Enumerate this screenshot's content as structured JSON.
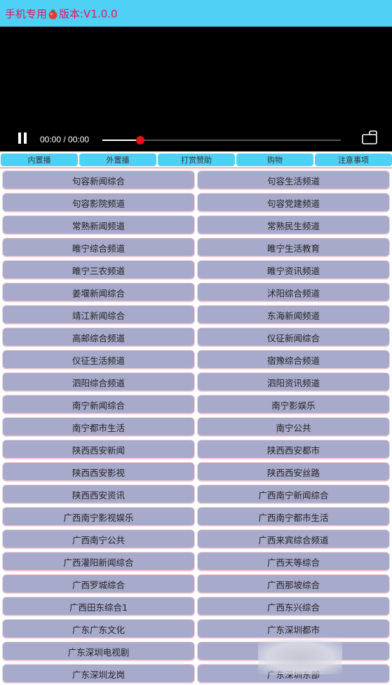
{
  "header": {
    "title_part1": "手机专用",
    "title_part2": "版本:V1.0.0",
    "logo_icon": "tomato-icon",
    "title_color": "#d81b60",
    "bg_color": "#4fd0f5"
  },
  "player": {
    "time": "00:00 / 00:00",
    "progress": 0.16,
    "pause_icon": "pause-icon",
    "fullscreen_icon": "fullscreen-icon",
    "knob_color": "#e8101f"
  },
  "tabs": [
    "内置播",
    "外置播",
    "打赏赞助",
    "购物",
    "注意事项"
  ],
  "channels": [
    [
      "句容新闻综合",
      "句容生活频道"
    ],
    [
      "句容影院频道",
      "句容党建频道"
    ],
    [
      "常熟新闻频道",
      "常熟民生频道"
    ],
    [
      "睢宁综合频道",
      "睢宁生活教育"
    ],
    [
      "睢宁三农频道",
      "睢宁资讯频道"
    ],
    [
      "姜堰新闻综合",
      "沭阳综合频道"
    ],
    [
      "靖江新闻综合",
      "东海新闻频道"
    ],
    [
      "高邮综合频道",
      "仪征新闻综合"
    ],
    [
      "仪征生活频道",
      "宿豫综合频道"
    ],
    [
      "泗阳综合频道",
      "泗阳资讯频道"
    ],
    [
      "南宁新闻综合",
      "南宁影娱乐"
    ],
    [
      "南宁都市生活",
      "南宁公共"
    ],
    [
      "陕西西安新闻",
      "陕西西安都市"
    ],
    [
      "陕西西安影视",
      "陕西西安丝路"
    ],
    [
      "陕西西安资讯",
      "广西南宁新闻综合"
    ],
    [
      "广西南宁影视娱乐",
      "广西南宁都市生活"
    ],
    [
      "广西南宁公共",
      "广西来宾综合频道"
    ],
    [
      "广西灌阳新闻综合",
      "广西天等综合"
    ],
    [
      "广西罗城综合",
      "广西那坡综合"
    ],
    [
      "广西田东综合1",
      "广西东兴综合"
    ],
    [
      "广东广东文化",
      "广东深圳都市"
    ],
    [
      "广东深圳电视剧",
      ""
    ],
    [
      "广东深圳龙岗",
      "广东深圳东部"
    ]
  ]
}
